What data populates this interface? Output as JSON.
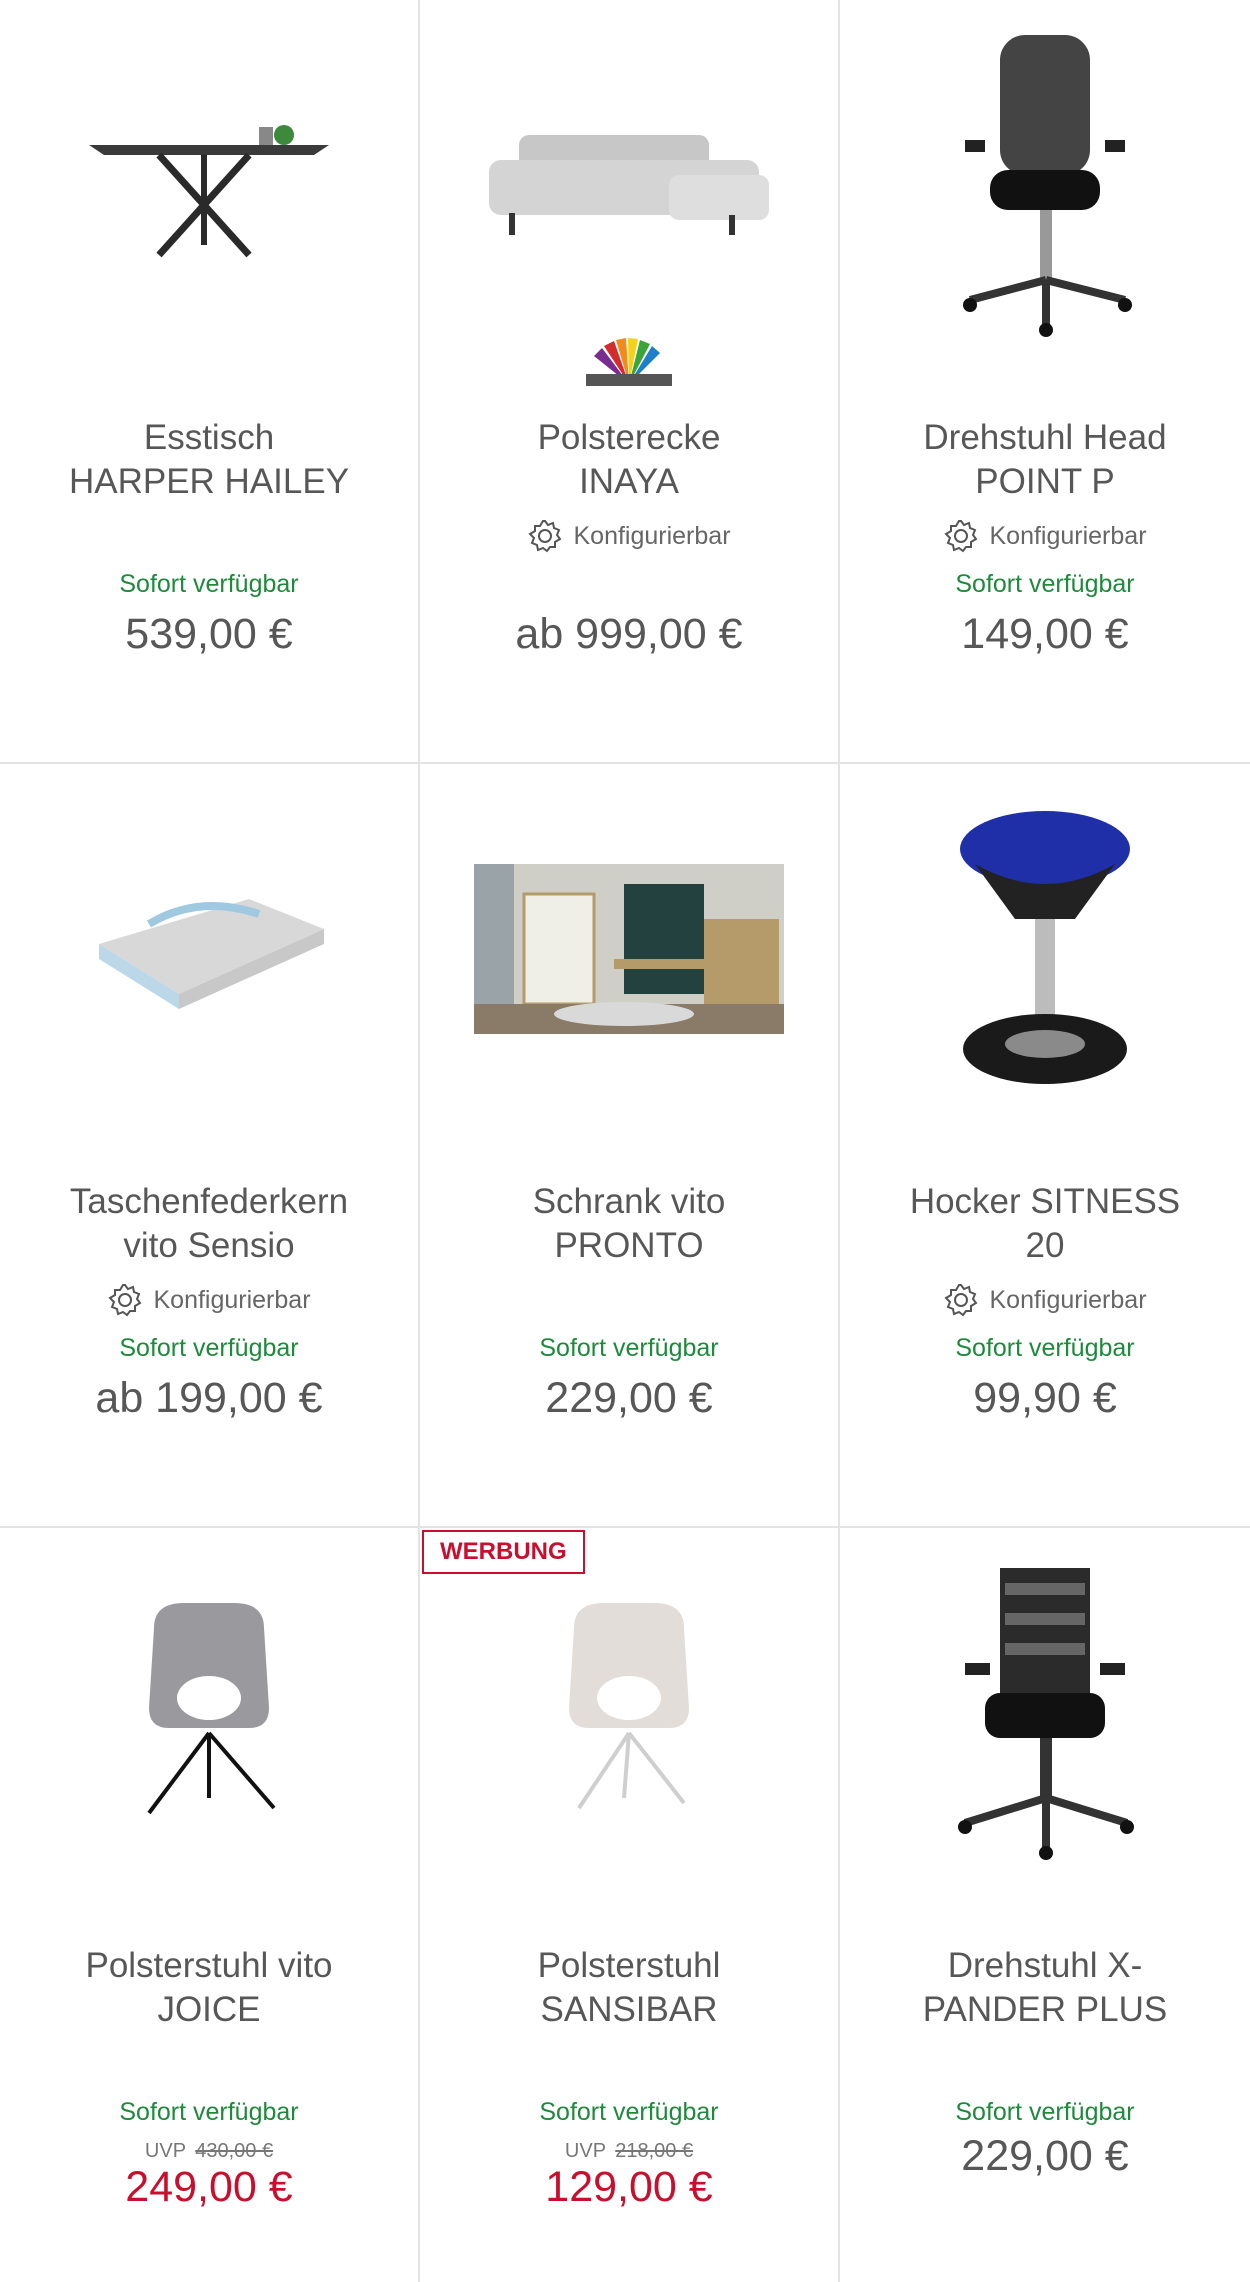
{
  "products": [
    {
      "title": "Esstisch\nHARPER HAILEY",
      "config": "",
      "availability": "Sofort verfügbar",
      "price": "539,00 €"
    },
    {
      "title": "Polsterecke\nINAYA",
      "config": "Konfigurierbar",
      "availability": "",
      "price": "ab 999,00 €"
    },
    {
      "title": "Drehstuhl Head\nPOINT P",
      "config": "Konfigurierbar",
      "availability": "Sofort verfügbar",
      "price": "149,00 €"
    },
    {
      "title": "Taschenfederkern\nvito Sensio",
      "config": "Konfigurierbar",
      "availability": "Sofort verfügbar",
      "price": "ab 199,00 €"
    },
    {
      "title": "Schrank vito\nPRONTO",
      "config": "",
      "availability": "Sofort verfügbar",
      "price": "229,00 €"
    },
    {
      "title": "Hocker SITNESS\n20",
      "config": "Konfigurierbar",
      "availability": "Sofort verfügbar",
      "price": "99,90 €"
    },
    {
      "title": "Polsterstuhl vito\nJOICE",
      "config": "",
      "availability": "Sofort verfügbar",
      "uvp_label": "UVP",
      "uvp_old": "430,00 €",
      "price": "249,00 €"
    },
    {
      "title": "Polsterstuhl\nSANSIBAR",
      "config": "",
      "availability": "Sofort verfügbar",
      "uvp_label": "UVP",
      "uvp_old": "218,00 €",
      "price": "129,00 €",
      "badge": "WERBUNG"
    },
    {
      "title": "Drehstuhl X-\nPANDER PLUS",
      "config": "",
      "availability": "Sofort verfügbar",
      "price": "229,00 €"
    }
  ],
  "colors": {
    "available": "#1e8a3c",
    "sale": "#c8102e",
    "text": "#575757",
    "divider": "#e3e3e3"
  }
}
